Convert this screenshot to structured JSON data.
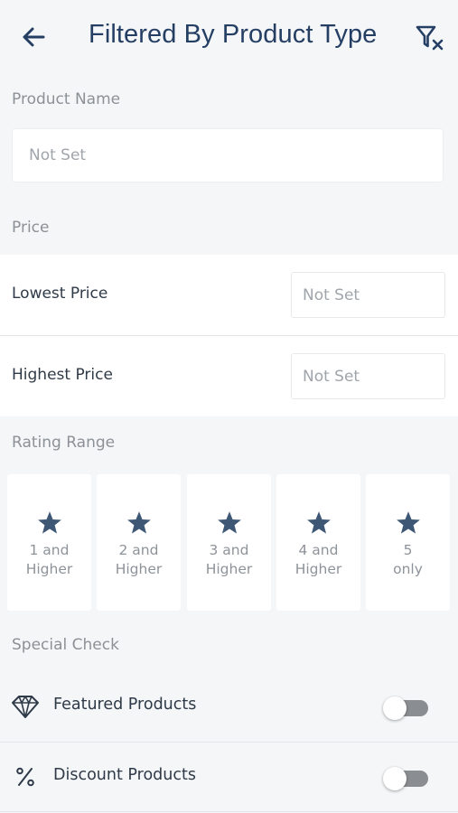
{
  "header": {
    "back_icon": "arrow-left-icon",
    "title": "Filtered By Product Type",
    "clear_filter_icon": "filter-clear-icon"
  },
  "product_name": {
    "label": "Product Name",
    "placeholder": "Not Set"
  },
  "price": {
    "label": "Price",
    "lowest_label": "Lowest Price",
    "lowest_placeholder": "Not Set",
    "highest_label": "Highest Price",
    "highest_placeholder": "Not Set"
  },
  "rating": {
    "label": "Rating Range",
    "options": [
      {
        "line1": "1 and",
        "line2": "Higher"
      },
      {
        "line1": "2 and",
        "line2": "Higher"
      },
      {
        "line1": "3 and",
        "line2": "Higher"
      },
      {
        "line1": "4 and",
        "line2": "Higher"
      },
      {
        "line1": "5",
        "line2": "only"
      }
    ]
  },
  "special": {
    "label": "Special Check",
    "items": [
      {
        "label": "Featured Products",
        "icon": "diamond-icon",
        "enabled": false
      },
      {
        "label": "Discount Products",
        "icon": "percent-icon",
        "enabled": false
      }
    ]
  },
  "colors": {
    "accent": "#243f63",
    "star": "#3e5775",
    "background": "#f5f6f8"
  }
}
